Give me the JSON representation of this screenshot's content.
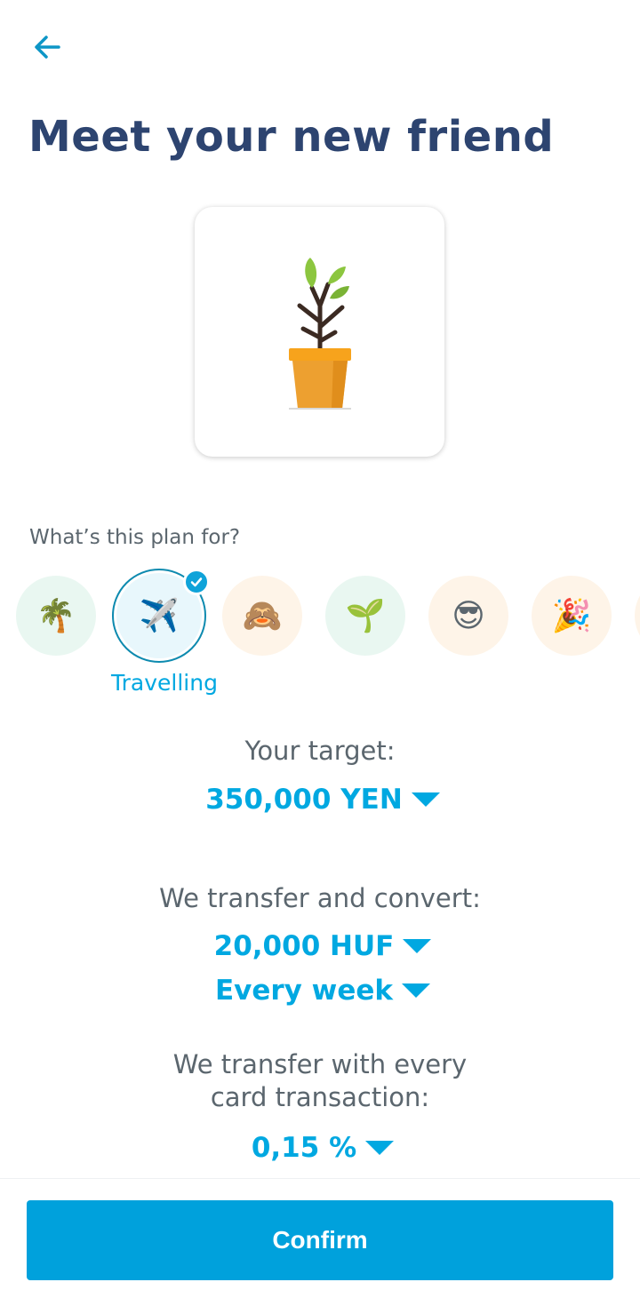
{
  "header": {
    "back_icon": "arrow-left-icon",
    "title": "Meet your new friend"
  },
  "plant": {
    "icon": "potted-plant-icon"
  },
  "plan": {
    "label": "What’s this plan for?",
    "selected_label": "Travelling",
    "options": [
      {
        "emoji": "🌴",
        "bg": "#e9f7f1"
      },
      {
        "emoji": "✈️",
        "bg": "#e8f7fc"
      },
      {
        "emoji": "🙈",
        "bg": "#fef4e8"
      },
      {
        "emoji": "🌱",
        "bg": "#e9f7f1"
      },
      {
        "emoji": "😎",
        "bg": "#fef4e8"
      },
      {
        "emoji": "🎉",
        "bg": "#fef4e8"
      }
    ]
  },
  "target": {
    "label": "Your target:",
    "value": "350,000 YEN"
  },
  "transfer": {
    "label": "We transfer and convert:",
    "amount": "20,000 HUF",
    "frequency": "Every week"
  },
  "card_transfer": {
    "label_line1": "We transfer with every",
    "label_line2": "card transaction:",
    "value": "0,15 %"
  },
  "footer": {
    "confirm_label": "Confirm"
  },
  "colors": {
    "accent": "#00a8e1",
    "title": "#2d4470",
    "button": "#00a1dc"
  }
}
